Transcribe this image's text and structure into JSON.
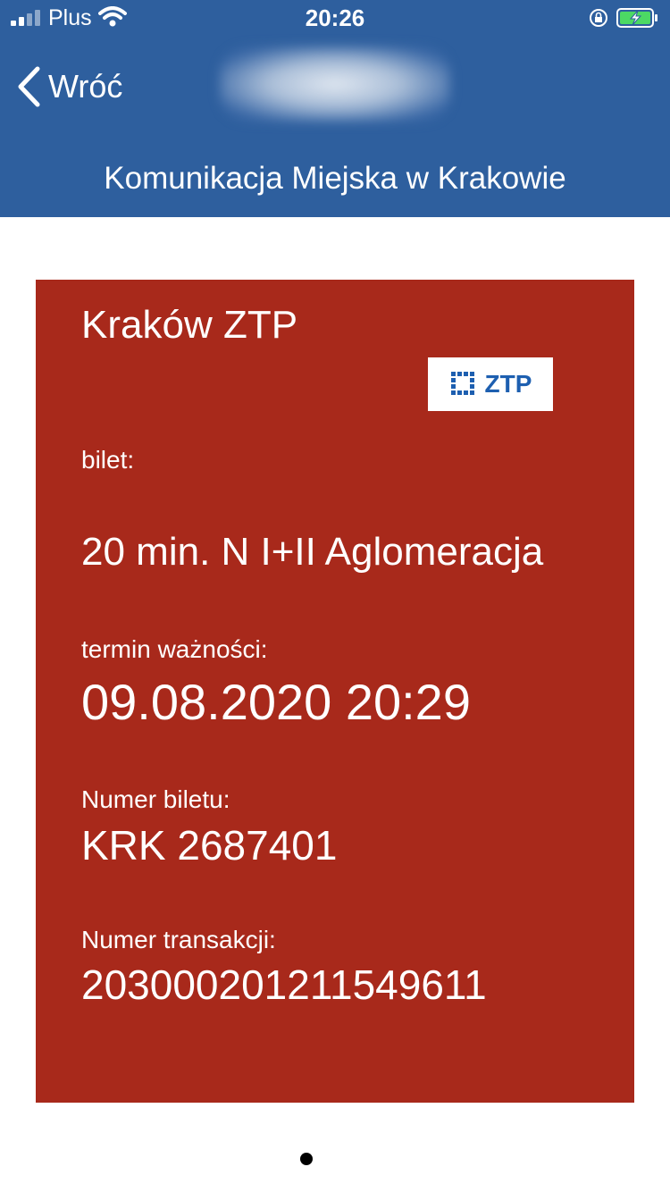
{
  "status_bar": {
    "carrier": "Plus",
    "time": "20:26"
  },
  "nav": {
    "back_label": "Wróć",
    "subtitle": "Komunikacja Miejska w Krakowie"
  },
  "ticket": {
    "title": "Kraków ZTP",
    "logo_text": "ZTP",
    "ticket_label": "bilet:",
    "ticket_value": "20 min. N I+II Aglomeracja",
    "expiry_label": "termin ważności:",
    "expiry_value": "09.08.2020 20:29",
    "ticket_number_label": "Numer biletu:",
    "ticket_number_value": "KRK 2687401",
    "transaction_label": "Numer transakcji:",
    "transaction_value": "20300020121154961​1"
  },
  "colors": {
    "nav_background": "#2e5f9e",
    "card_background": "#a8291b",
    "logo_blue": "#1d5fb0"
  },
  "icons": [
    "signal-icon",
    "wifi-icon",
    "orientation-lock-icon",
    "battery-charging-icon",
    "chevron-left-icon",
    "ztp-logo-icon"
  ]
}
